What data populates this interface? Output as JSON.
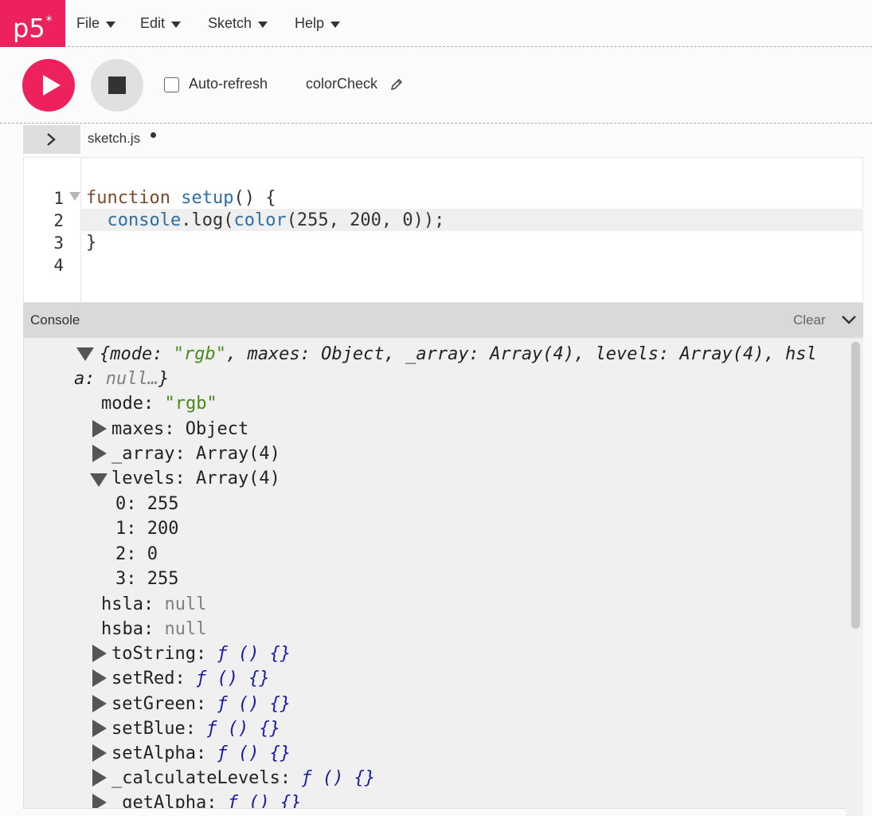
{
  "nav": {
    "logo": "p5",
    "logo_mark": "*",
    "menu": [
      {
        "label": "File"
      },
      {
        "label": "Edit"
      },
      {
        "label": "Sketch"
      },
      {
        "label": "Help"
      }
    ]
  },
  "toolbar": {
    "auto_refresh_label": "Auto-refresh",
    "auto_refresh_checked": false,
    "sketch_name": "colorCheck"
  },
  "editor": {
    "tab_name": "sketch.js",
    "line_numbers": [
      "1",
      "2",
      "3",
      "4"
    ],
    "code": {
      "l1_keyword": "function",
      "l1_name": "setup",
      "l1_rest": "() {",
      "l2_indent": "  ",
      "l2_obj": "console",
      "l2_method": ".log(",
      "l2_fn": "color",
      "l2_args": "(255, 200, 0));",
      "l3": "}"
    }
  },
  "console": {
    "title": "Console",
    "clear_label": "Clear",
    "summary_line1": "{mode: ",
    "summary_mode_val": "\"rgb\"",
    "summary_line1_rest": ", maxes: Object, _array: Array(4), levels: Array(4), hsl",
    "summary_line2_pre": "a: ",
    "summary_line2_null": "null…",
    "summary_line2_close": "}",
    "rows": {
      "mode_key": "mode: ",
      "mode_val": "\"rgb\"",
      "maxes": "maxes: Object",
      "array": "_array: Array(4)",
      "levels": "levels: Array(4)",
      "lv0": "0: 255",
      "lv1": "1: 200",
      "lv2": "2: 0",
      "lv3": "3: 255",
      "hsla_key": "hsla: ",
      "hsla_val": "null",
      "hsba_key": "hsba: ",
      "hsba_val": "null",
      "toString": "toString: ",
      "setRed": "setRed: ",
      "setGreen": "setGreen: ",
      "setBlue": "setBlue: ",
      "setAlpha": "setAlpha: ",
      "calculateLevels": "_calculateLevels: ",
      "getAlpha": "_getAlpha: ",
      "fn_symbol": "ƒ",
      "fn_body": " () {}"
    }
  },
  "colors": {
    "accent": "#ed225d",
    "string": "#4a8a1c",
    "function_symbol": "#1a1aa6"
  }
}
